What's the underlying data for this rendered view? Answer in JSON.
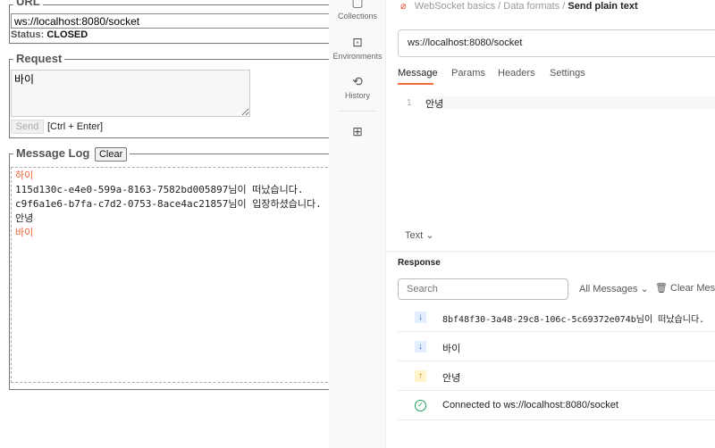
{
  "left": {
    "url_legend": "URL",
    "url_value": "ws://localhost:8080/socket",
    "status_label": "Status:",
    "status_value": "CLOSED",
    "request_legend": "Request",
    "request_value": "바이",
    "send_label": "Send",
    "send_hint": "[Ctrl + Enter]",
    "log_legend": "Message Log",
    "clear_label": "Clear",
    "log": [
      {
        "text": "하이",
        "color": "#e8623a"
      },
      {
        "text": "115d130c-e4e0-599a-8163-7582bd005897님이 떠났습니다.",
        "color": "#222222"
      },
      {
        "text": "c9f6a1e6-b7fa-c7d2-0753-8ace4ac21857님이 입장하셨습니다.",
        "color": "#222222"
      },
      {
        "text": "안녕",
        "color": "#222222"
      },
      {
        "text": "바이",
        "color": "#e8623a"
      }
    ]
  },
  "sidebar": {
    "items": [
      {
        "label": "Collections"
      },
      {
        "label": "Environments"
      },
      {
        "label": "History"
      }
    ]
  },
  "main": {
    "breadcrumb": [
      "WebSocket basics",
      "Data formats",
      "Send plain text"
    ],
    "url_value": "ws://localhost:8080/socket",
    "tabs": [
      "Message",
      "Params",
      "Headers",
      "Settings"
    ],
    "editor": {
      "line_number": "1",
      "content": "안녕"
    },
    "format_label": "Text",
    "response_title": "Response",
    "search_placeholder": "Search",
    "filter_label": "All Messages",
    "clear_label": "Clear Messages",
    "messages": [
      {
        "dir": "down",
        "text": "8bf48f30-3a48-29c8-106c-5c69372e074b님이 떠났습니다."
      },
      {
        "dir": "down",
        "text": "바이"
      },
      {
        "dir": "up",
        "text": "안녕"
      },
      {
        "dir": "connected",
        "text": "Connected to ws://localhost:8080/socket"
      }
    ]
  },
  "colors": {
    "accent": "#f26b3a",
    "down_bg": "#e3efff",
    "up_bg": "#fff4cc",
    "connected": "#1f9d55"
  }
}
